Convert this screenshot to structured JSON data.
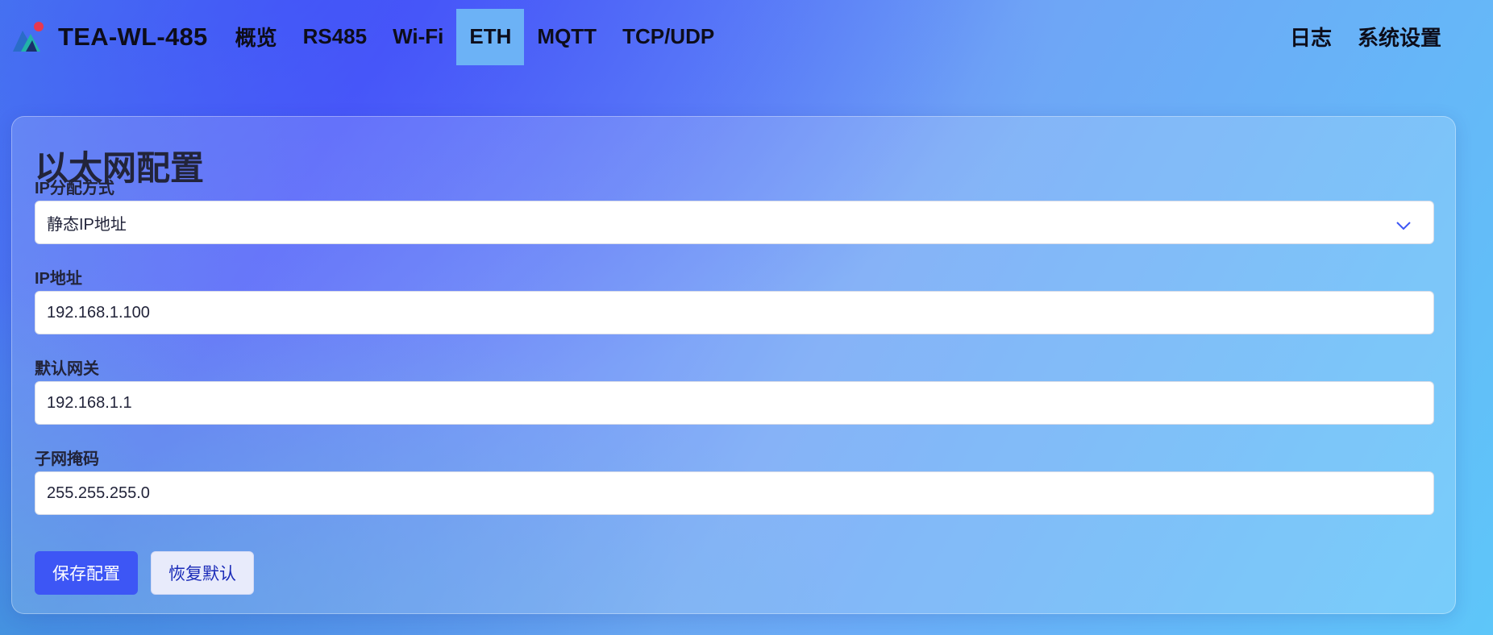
{
  "brand": {
    "name": "TEA-WL-485"
  },
  "nav": {
    "items": [
      {
        "label": "概览"
      },
      {
        "label": "RS485"
      },
      {
        "label": "Wi-Fi"
      },
      {
        "label": "ETH",
        "active": true
      },
      {
        "label": "MQTT"
      },
      {
        "label": "TCP/UDP"
      }
    ],
    "right": [
      {
        "label": "日志"
      },
      {
        "label": "系统设置"
      }
    ]
  },
  "form": {
    "title": "以太网配置",
    "ip_mode": {
      "label": "IP分配方式",
      "value": "静态IP地址"
    },
    "ip_address": {
      "label": "IP地址",
      "value": "192.168.1.100"
    },
    "gateway": {
      "label": "默认网关",
      "value": "192.168.1.1"
    },
    "netmask": {
      "label": "子网掩码",
      "value": "255.255.255.0"
    },
    "save_label": "保存配置",
    "reset_label": "恢复默认"
  },
  "colors": {
    "accent": "#3d56f5",
    "active_tab": "#6cb2f6",
    "logo_dot": "#e8384f"
  }
}
